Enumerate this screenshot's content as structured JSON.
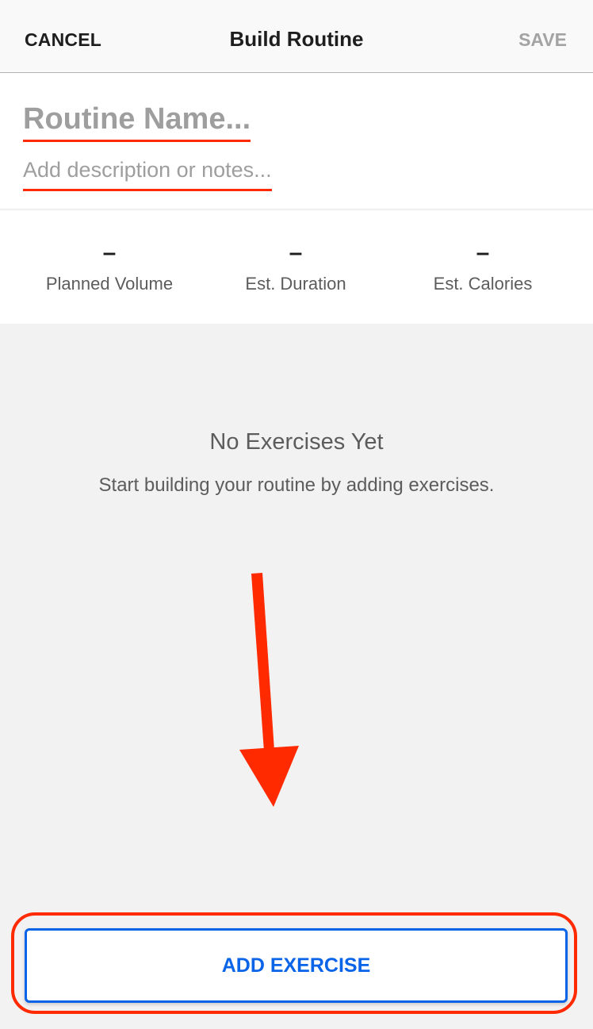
{
  "navbar": {
    "cancel_label": "CANCEL",
    "title": "Build Routine",
    "save_label": "SAVE"
  },
  "form": {
    "name_placeholder": "Routine Name...",
    "name_value": "",
    "description_placeholder": "Add description or notes...",
    "description_value": ""
  },
  "stats": [
    {
      "value": "–",
      "label": "Planned Volume"
    },
    {
      "value": "–",
      "label": "Est. Duration"
    },
    {
      "value": "–",
      "label": "Est. Calories"
    }
  ],
  "empty_state": {
    "title": "No Exercises Yet",
    "subtitle": "Start building your routine by adding exercises."
  },
  "add_exercise_label": "ADD EXERCISE",
  "colors": {
    "accent_blue": "#0a64e8",
    "annotation_red": "#ff2a00",
    "placeholder_gray": "#9e9e9e"
  }
}
